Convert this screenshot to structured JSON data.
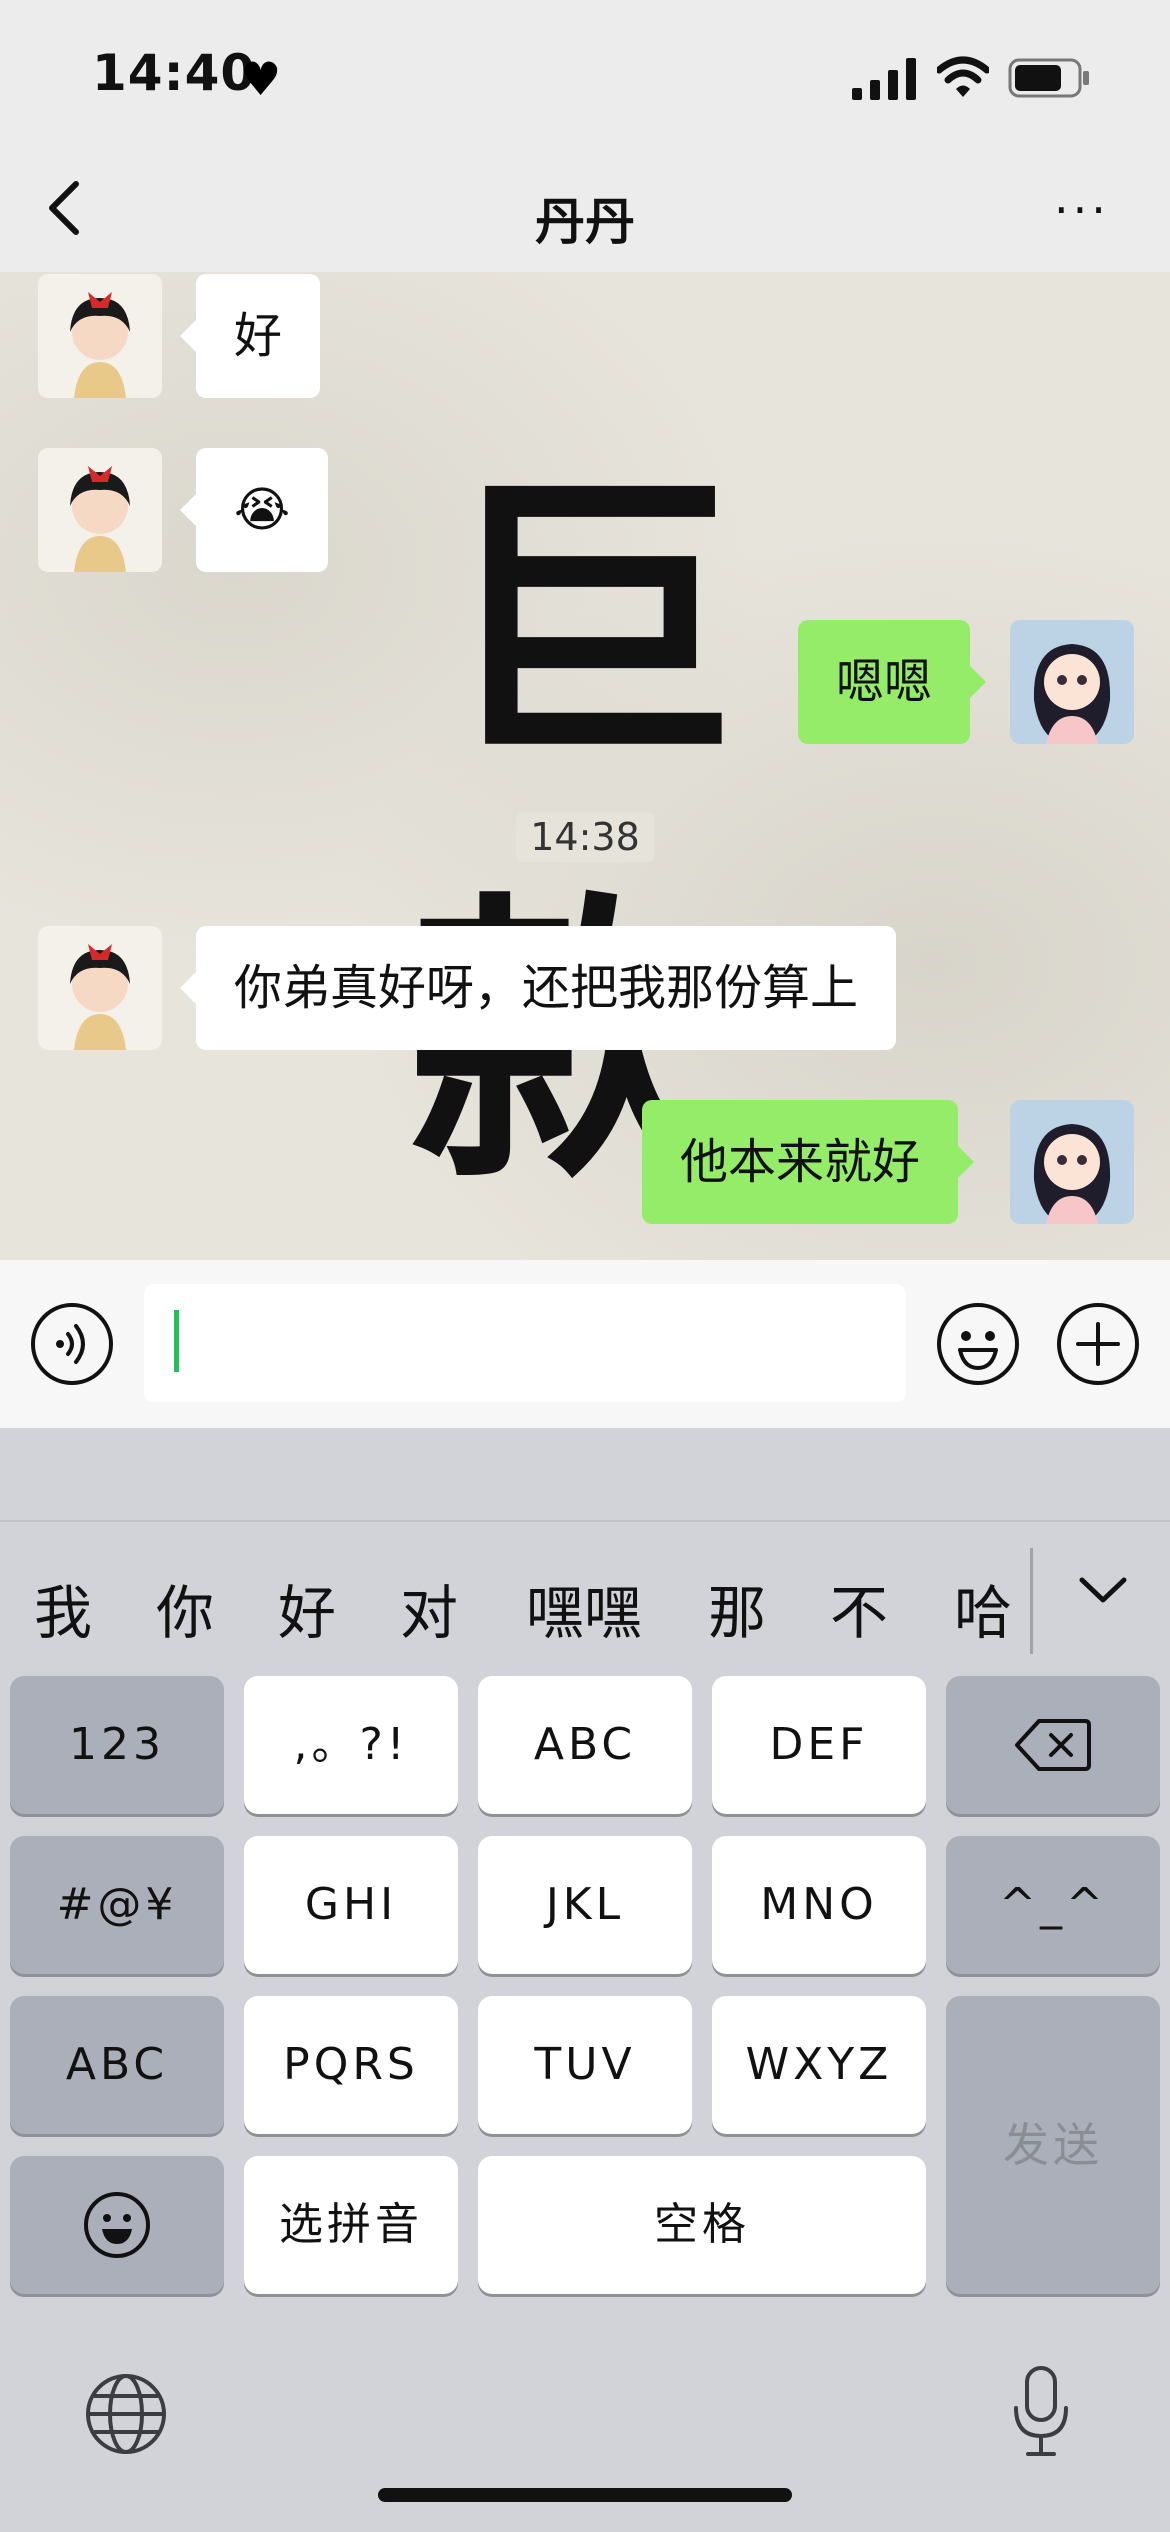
{
  "status_bar": {
    "time": "14:40",
    "heart_icon": "heart-icon",
    "signal_icon": "cellular-signal-icon",
    "wifi_icon": "wifi-icon",
    "battery_icon": "battery-icon"
  },
  "nav": {
    "title": "丹丹",
    "back_icon": "chevron-left-icon",
    "more_label": "···"
  },
  "chat": {
    "wallpaper_chars": [
      "巨",
      "款"
    ],
    "messages": [
      {
        "side": "in",
        "text": "好"
      },
      {
        "side": "in",
        "text": "😭"
      },
      {
        "side": "out",
        "text": "嗯嗯"
      },
      {
        "side": "in",
        "text": "你弟真好呀，还把我那份算上"
      },
      {
        "side": "out",
        "text": "他本来就好"
      }
    ],
    "timestamp": "14:38"
  },
  "input_bar": {
    "voice_icon": "voice-icon",
    "emoji_icon": "smiley-icon",
    "plus_icon": "plus-circle-icon",
    "value": ""
  },
  "keyboard": {
    "candidates": [
      "我",
      "你",
      "好",
      "对",
      "嘿嘿",
      "那",
      "不",
      "哈"
    ],
    "collapse_icon": "chevron-down-icon",
    "rows": [
      [
        "123",
        ",。?!",
        "ABC",
        "DEF",
        "⌫"
      ],
      [
        "#@¥",
        "GHI",
        "JKL",
        "MNO",
        "^_^"
      ],
      [
        "ABC",
        "PQRS",
        "TUV",
        "WXYZ",
        "发送"
      ],
      [
        "☺",
        "选拼音",
        "空格"
      ]
    ],
    "globe_icon": "globe-icon",
    "mic_icon": "microphone-icon"
  },
  "colors": {
    "outgoing_bubble": "#95ec69",
    "incoming_bubble": "#ffffff",
    "caret": "#21c05c",
    "keyboard_bg": "#d1d3d9"
  }
}
